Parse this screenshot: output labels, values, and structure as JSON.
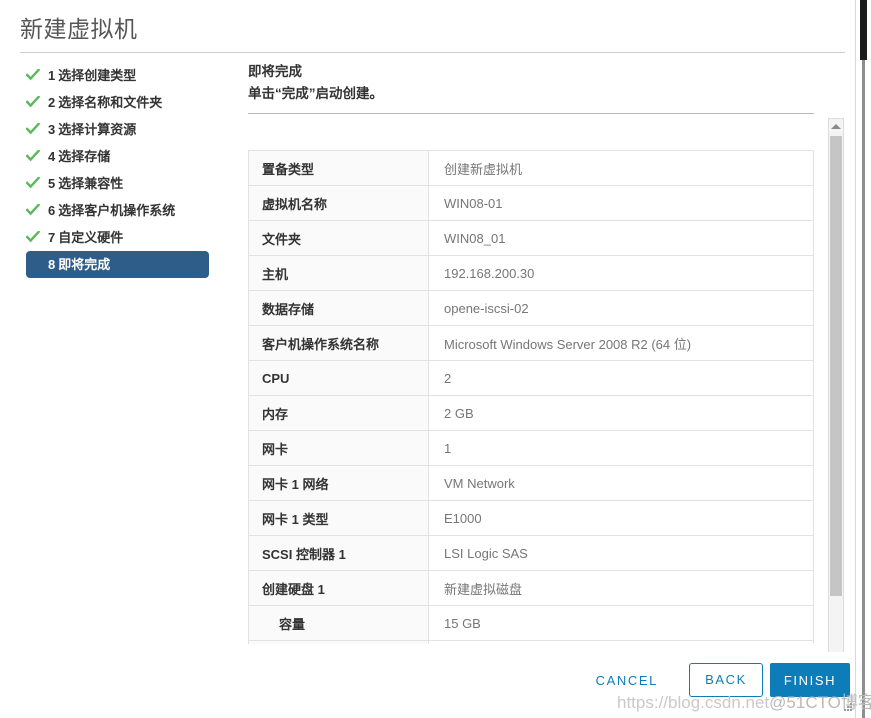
{
  "dialog": {
    "title": "新建虚拟机"
  },
  "steps": [
    {
      "num": "1",
      "label": "选择创建类型",
      "state": "done"
    },
    {
      "num": "2",
      "label": "选择名称和文件夹",
      "state": "done"
    },
    {
      "num": "3",
      "label": "选择计算资源",
      "state": "done"
    },
    {
      "num": "4",
      "label": "选择存储",
      "state": "done"
    },
    {
      "num": "5",
      "label": "选择兼容性",
      "state": "done"
    },
    {
      "num": "6",
      "label": "选择客户机操作系统",
      "state": "done"
    },
    {
      "num": "7",
      "label": "自定义硬件",
      "state": "done"
    },
    {
      "num": "8",
      "label": "即将完成",
      "state": "active"
    }
  ],
  "content": {
    "heading": "即将完成",
    "subheading": "单击“完成”启动创建。",
    "rows": [
      {
        "key": "置备类型",
        "value": "创建新虚拟机",
        "indent": false
      },
      {
        "key": "虚拟机名称",
        "value": "WIN08-01",
        "indent": false
      },
      {
        "key": "文件夹",
        "value": "WIN08_01",
        "indent": false
      },
      {
        "key": "主机",
        "value": "192.168.200.30",
        "indent": false
      },
      {
        "key": "数据存储",
        "value": "opene-iscsi-02",
        "indent": false
      },
      {
        "key": "客户机操作系统名称",
        "value": "Microsoft Windows Server 2008 R2 (64 位)",
        "indent": false
      },
      {
        "key": "CPU",
        "value": "2",
        "indent": false
      },
      {
        "key": "内存",
        "value": "2 GB",
        "indent": false
      },
      {
        "key": "网卡",
        "value": "1",
        "indent": false
      },
      {
        "key": "网卡 1 网络",
        "value": "VM Network",
        "indent": false
      },
      {
        "key": "网卡 1 类型",
        "value": "E1000",
        "indent": false
      },
      {
        "key": "SCSI 控制器 1",
        "value": "LSI Logic SAS",
        "indent": false
      },
      {
        "key": "创建硬盘 1",
        "value": "新建虚拟磁盘",
        "indent": false
      },
      {
        "key": "容量",
        "value": "15 GB",
        "indent": true
      },
      {
        "key": "",
        "value": "",
        "indent": false
      }
    ]
  },
  "footer": {
    "cancel_label": "CANCEL",
    "back_label": "BACK",
    "finish_label": "FINISH"
  },
  "watermark": {
    "url": "https://blog.csdn.net",
    "handle": "@51CTO博客"
  },
  "colors": {
    "accent_blue": "#0d7dba",
    "active_step_bg": "#2f5d8a",
    "check_green": "#5cb85c",
    "key_cell_bg": "#fafafa",
    "value_text": "#767676",
    "border": "#e2e2e2"
  }
}
